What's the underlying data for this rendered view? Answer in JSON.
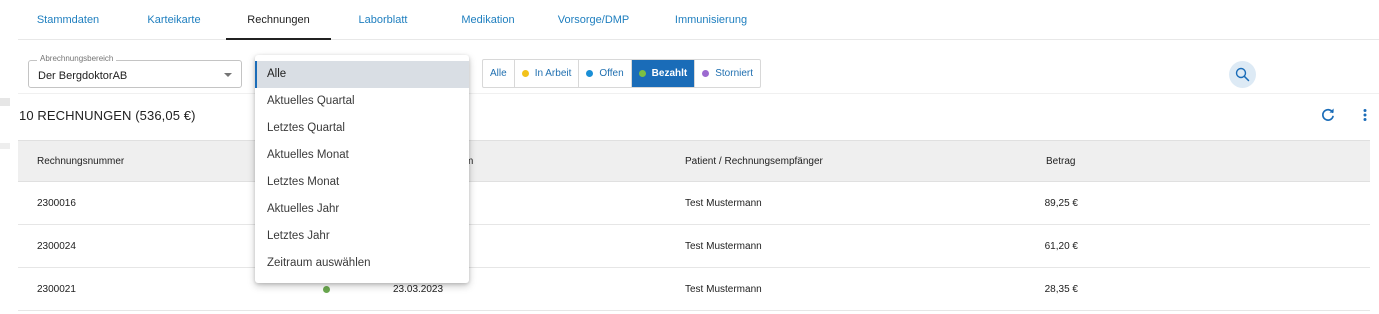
{
  "tabs": [
    {
      "label": "Stammdaten"
    },
    {
      "label": "Karteikarte"
    },
    {
      "label": "Rechnungen"
    },
    {
      "label": "Laborblatt"
    },
    {
      "label": "Medikation"
    },
    {
      "label": "Vorsorge/DMP"
    },
    {
      "label": "Immunisierung"
    }
  ],
  "filter": {
    "legend": "Abrechnungsbereich",
    "value": "Der BergdoktorAB"
  },
  "status_chips": [
    {
      "label": "Alle",
      "color": ""
    },
    {
      "label": "In Arbeit",
      "color": "#f2c21b"
    },
    {
      "label": "Offen",
      "color": "#1a8fd6"
    },
    {
      "label": "Bezahlt",
      "color": "#7bc043"
    },
    {
      "label": "Storniert",
      "color": "#9c6ad0"
    }
  ],
  "icons": {
    "search": "search-icon",
    "refresh": "refresh-icon",
    "more": "more-vert-icon",
    "caret": "chevron-down-icon"
  },
  "heading": "10 RECHNUNGEN (536,05 €)",
  "table": {
    "columns": [
      "Rechnungsnummer",
      "m",
      "Patient / Rechnungsempfänger",
      "Betrag"
    ],
    "rows": [
      {
        "number": "2300016",
        "date": "",
        "patient": "Test Mustermann",
        "amount": "89,25 €"
      },
      {
        "number": "2300024",
        "date": "",
        "patient": "Test Mustermann",
        "amount": "61,20 €"
      },
      {
        "number": "2300021",
        "date": "23.03.2023",
        "patient": "Test Mustermann",
        "amount": "28,35 €"
      }
    ]
  },
  "dropdown": {
    "options": [
      "Alle",
      "Aktuelles Quartal",
      "Letztes Quartal",
      "Aktuelles Monat",
      "Letztes Monat",
      "Aktuelles Jahr",
      "Letztes Jahr",
      "Zeitraum auswählen"
    ],
    "selected": "Alle"
  },
  "colors": {
    "accent": "#1a6cb8",
    "link": "#1f7fbf",
    "paid_dot": "#6aa84f"
  }
}
